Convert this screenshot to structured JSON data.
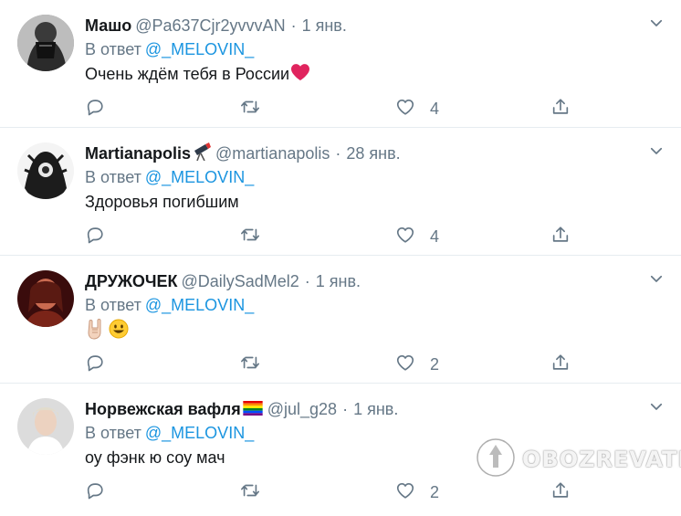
{
  "tweets": [
    {
      "name": "Машо",
      "handle": "@Pa637Cjr2yvvvAN",
      "separator": "·",
      "date": "1 янв.",
      "reply_prefix": "В ответ",
      "reply_to": "@_MELOVIN_",
      "text": "Очень ждём тебя в России",
      "text_emoji": "red-heart",
      "name_emoji": "",
      "reply_count": "",
      "retweet_count": "",
      "like_count": "4"
    },
    {
      "name": "Martianapolis",
      "handle": "@martianapolis",
      "separator": "·",
      "date": "28 янв.",
      "reply_prefix": "В ответ",
      "reply_to": "@_MELOVIN_",
      "text": "Здоровья погибшим",
      "name_emoji": "telescope",
      "reply_count": "",
      "retweet_count": "",
      "like_count": "4"
    },
    {
      "name": "ДРУЖОЧЕК",
      "handle": "@DailySadMel2",
      "separator": "·",
      "date": "1 янв.",
      "reply_prefix": "В ответ",
      "reply_to": "@_MELOVIN_",
      "text": "",
      "text_emoji": "sign-of-horns, smiley",
      "reply_count": "",
      "retweet_count": "",
      "like_count": "2"
    },
    {
      "name": "Норвежская вафля",
      "handle": "@jul_g28",
      "separator": "·",
      "date": "1 янв.",
      "reply_prefix": "В ответ",
      "reply_to": "@_MELOVIN_",
      "text": "оу фэнк ю соу мач",
      "name_emoji": "rainbow-flag",
      "reply_count": "",
      "retweet_count": "",
      "like_count": "2"
    }
  ],
  "icons": {
    "reply": "reply-icon",
    "retweet": "retweet-icon",
    "like": "heart-icon",
    "share": "share-icon",
    "menu": "chevron-down-icon"
  },
  "colors": {
    "mention": "#1b95e0",
    "secondary": "#657786",
    "divider": "#e6ecf0",
    "heart_emoji": "#e0245e"
  },
  "watermark": {
    "text": "OBOZREVATEL",
    "logo": "obozrevatel-logo"
  }
}
